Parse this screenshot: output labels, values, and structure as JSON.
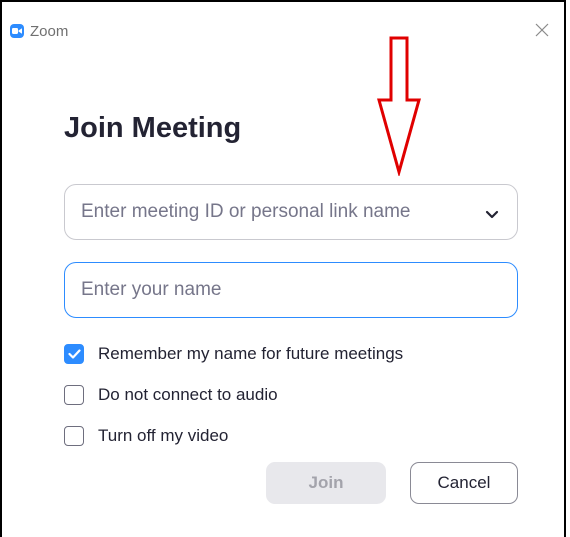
{
  "window": {
    "app_title": "Zoom"
  },
  "dialog": {
    "heading": "Join Meeting",
    "meeting_id_field": {
      "placeholder": "Enter meeting ID or personal link name",
      "value": ""
    },
    "name_field": {
      "placeholder": "Enter your name",
      "value": ""
    },
    "options": [
      {
        "label": "Remember my name for future meetings",
        "checked": true
      },
      {
        "label": "Do not connect to audio",
        "checked": false
      },
      {
        "label": "Turn off my video",
        "checked": false
      }
    ],
    "join_label": "Join",
    "cancel_label": "Cancel"
  },
  "colors": {
    "accent": "#2d8cff",
    "annotation_arrow": "#e00000",
    "heading": "#232333"
  },
  "icons": [
    "zoom-logo-icon",
    "close-icon",
    "chevron-down-icon",
    "checkmark-icon"
  ]
}
